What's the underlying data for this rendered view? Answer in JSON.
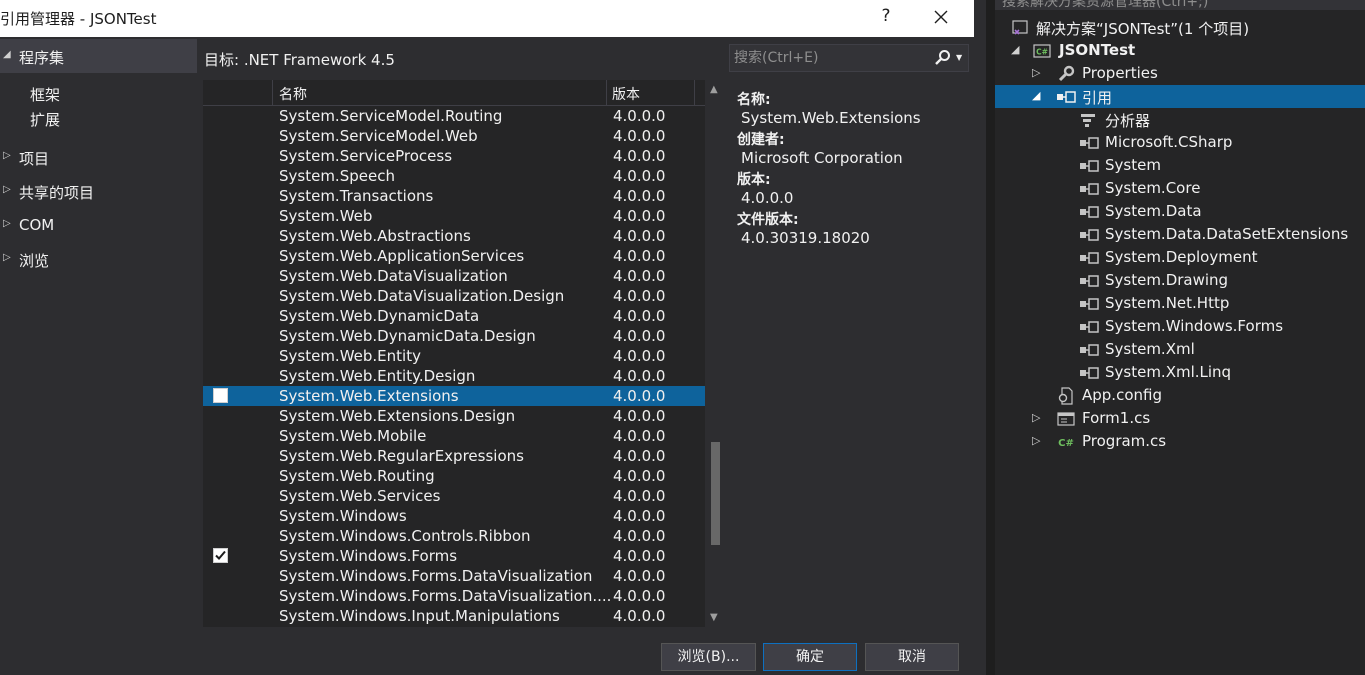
{
  "dialog": {
    "title": "引用管理器 - JSONTest",
    "help": "?",
    "nav": {
      "selected": "程序集",
      "sub_items": [
        "框架",
        "扩展"
      ],
      "groups": [
        "项目",
        "共享的项目",
        "COM",
        "浏览"
      ]
    },
    "target": "目标: .NET Framework 4.5",
    "search_placeholder": "搜索(Ctrl+E)",
    "columns": {
      "name": "名称",
      "version": "版本"
    },
    "rows": [
      {
        "name": "System.ServiceModel.Routing",
        "version": "4.0.0.0"
      },
      {
        "name": "System.ServiceModel.Web",
        "version": "4.0.0.0"
      },
      {
        "name": "System.ServiceProcess",
        "version": "4.0.0.0"
      },
      {
        "name": "System.Speech",
        "version": "4.0.0.0"
      },
      {
        "name": "System.Transactions",
        "version": "4.0.0.0"
      },
      {
        "name": "System.Web",
        "version": "4.0.0.0"
      },
      {
        "name": "System.Web.Abstractions",
        "version": "4.0.0.0"
      },
      {
        "name": "System.Web.ApplicationServices",
        "version": "4.0.0.0"
      },
      {
        "name": "System.Web.DataVisualization",
        "version": "4.0.0.0"
      },
      {
        "name": "System.Web.DataVisualization.Design",
        "version": "4.0.0.0"
      },
      {
        "name": "System.Web.DynamicData",
        "version": "4.0.0.0"
      },
      {
        "name": "System.Web.DynamicData.Design",
        "version": "4.0.0.0"
      },
      {
        "name": "System.Web.Entity",
        "version": "4.0.0.0"
      },
      {
        "name": "System.Web.Entity.Design",
        "version": "4.0.0.0"
      },
      {
        "name": "System.Web.Extensions",
        "version": "4.0.0.0",
        "selected": true,
        "checked": false
      },
      {
        "name": "System.Web.Extensions.Design",
        "version": "4.0.0.0"
      },
      {
        "name": "System.Web.Mobile",
        "version": "4.0.0.0"
      },
      {
        "name": "System.Web.RegularExpressions",
        "version": "4.0.0.0"
      },
      {
        "name": "System.Web.Routing",
        "version": "4.0.0.0"
      },
      {
        "name": "System.Web.Services",
        "version": "4.0.0.0"
      },
      {
        "name": "System.Windows",
        "version": "4.0.0.0"
      },
      {
        "name": "System.Windows.Controls.Ribbon",
        "version": "4.0.0.0"
      },
      {
        "name": "System.Windows.Forms",
        "version": "4.0.0.0",
        "checked": true
      },
      {
        "name": "System.Windows.Forms.DataVisualization",
        "version": "4.0.0.0"
      },
      {
        "name": "System.Windows.Forms.DataVisualization....",
        "version": "4.0.0.0"
      },
      {
        "name": "System.Windows.Input.Manipulations",
        "version": "4.0.0.0"
      }
    ],
    "details": [
      {
        "label": "名称:",
        "value": "System.Web.Extensions"
      },
      {
        "label": "创建者:",
        "value": "Microsoft Corporation"
      },
      {
        "label": "版本:",
        "value": "4.0.0.0"
      },
      {
        "label": "文件版本:",
        "value": "4.0.30319.18020"
      }
    ],
    "buttons": {
      "browse": "浏览(B)...",
      "ok": "确定",
      "cancel": "取消"
    }
  },
  "solution_explorer": {
    "search_placeholder": "搜索解决方案资源管理器(Ctrl+;)",
    "solution": "解决方案“JSONTest”(1 个项目)",
    "project": "JSONTest",
    "properties": "Properties",
    "references_label": "引用",
    "analyzer": "分析器",
    "references": [
      "Microsoft.CSharp",
      "System",
      "System.Core",
      "System.Data",
      "System.Data.DataSetExtensions",
      "System.Deployment",
      "System.Drawing",
      "System.Net.Http",
      "System.Windows.Forms",
      "System.Xml",
      "System.Xml.Linq"
    ],
    "files": [
      "App.config",
      "Form1.cs",
      "Program.cs"
    ],
    "icon_texts": {
      "csharp": "C#"
    }
  },
  "colors": {
    "selection": "#0e639c",
    "dialog_bg": "#2d2d30",
    "list_bg": "#252526",
    "accent": "#0e70c0"
  }
}
